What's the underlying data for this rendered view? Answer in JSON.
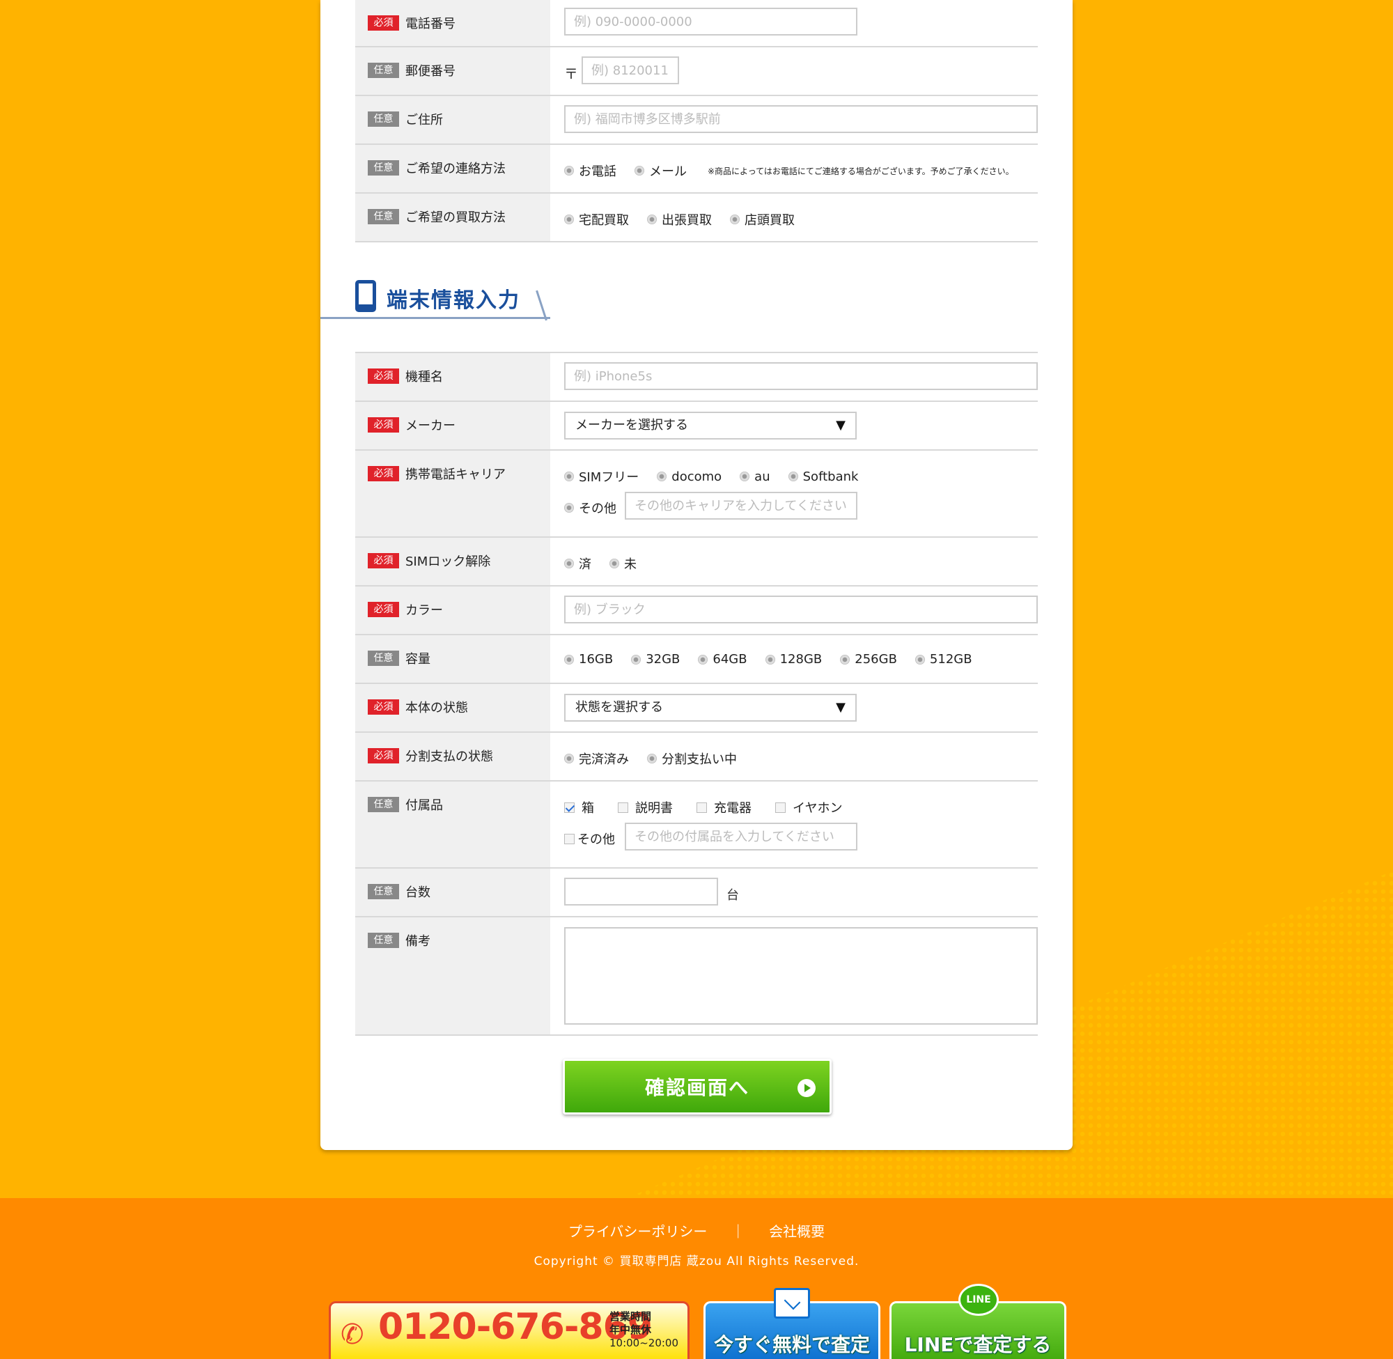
{
  "badges": {
    "required": "必須",
    "optional": "任意"
  },
  "contact": {
    "phone": {
      "label": "電話番号",
      "placeholder": "例) 090-0000-0000"
    },
    "postal": {
      "label": "郵便番号",
      "prefix": "〒",
      "placeholder": "例) 8120011"
    },
    "address": {
      "label": "ご住所",
      "placeholder": "例) 福岡市博多区博多駅前"
    },
    "contact_method": {
      "label": "ご希望の連絡方法",
      "options": [
        "お電話",
        "メール"
      ],
      "note": "※商品によってはお電話にてご連絡する場合がございます。予めご了承ください。"
    },
    "purchase_method": {
      "label": "ご希望の買取方法",
      "options": [
        "宅配買取",
        "出張買取",
        "店頭買取"
      ]
    }
  },
  "device_section": {
    "title": "端末情報入力"
  },
  "device": {
    "model": {
      "label": "機種名",
      "placeholder": "例) iPhone5s"
    },
    "maker": {
      "label": "メーカー",
      "selected": "メーカーを選択する",
      "arrow": "▼"
    },
    "carrier": {
      "label": "携帯電話キャリア",
      "options": [
        "SIMフリー",
        "docomo",
        "au",
        "Softbank"
      ],
      "other_label": "その他",
      "other_placeholder": "その他のキャリアを入力してください"
    },
    "sim_unlock": {
      "label": "SIMロック解除",
      "options": [
        "済",
        "未"
      ]
    },
    "color": {
      "label": "カラー",
      "placeholder": "例) ブラック"
    },
    "capacity": {
      "label": "容量",
      "options": [
        "16GB",
        "32GB",
        "64GB",
        "128GB",
        "256GB",
        "512GB"
      ]
    },
    "condition": {
      "label": "本体の状態",
      "selected": "状態を選択する",
      "arrow": "▼"
    },
    "installment": {
      "label": "分割支払の状態",
      "options": [
        "完済済み",
        "分割支払い中"
      ]
    },
    "accessories": {
      "label": "付属品",
      "options": [
        "箱",
        "説明書",
        "充電器",
        "イヤホン"
      ],
      "checked": [
        "箱"
      ],
      "other_label": "その他",
      "other_placeholder": "その他の付属品を入力してください"
    },
    "quantity": {
      "label": "台数",
      "unit": "台"
    },
    "remarks": {
      "label": "備考"
    }
  },
  "submit": {
    "label": "確認画面へ"
  },
  "footer": {
    "links": [
      "プライバシーポリシー",
      "会社概要"
    ],
    "separator": "｜",
    "copyright": "Copyright © 買取専門店 蔵zou All Rights Reserved."
  },
  "banners": {
    "tel": {
      "number": "0120-676-869",
      "hours_title": "営業時間",
      "holiday": "年中無休",
      "hours": "10:00~20:00"
    },
    "mail": {
      "label": "今すぐ無料で査定"
    },
    "line": {
      "badge": "LINE",
      "label": "LINEで査定する"
    }
  },
  "colors": {
    "background": "#ffb300",
    "footer": "#ff8a00",
    "required": "#e0222a",
    "optional": "#888888",
    "heading": "#1a4f9c",
    "submit": "#3fa80b"
  }
}
